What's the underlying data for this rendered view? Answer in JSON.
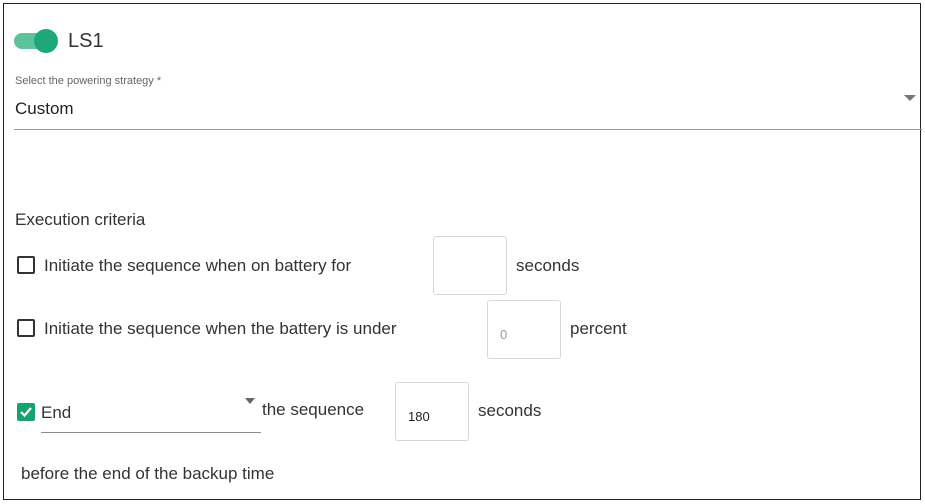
{
  "toggle": {
    "label": "LS1",
    "on": true
  },
  "strategy": {
    "caption": "Select the powering strategy *",
    "selected": "Custom"
  },
  "execution": {
    "title": "Execution criteria",
    "battery_time": {
      "checked": false,
      "label": "Initiate the sequence when on battery for",
      "value": "",
      "unit": "seconds"
    },
    "battery_level": {
      "checked": false,
      "label": "Initiate the sequence when the battery is under",
      "placeholder": "0",
      "unit": "percent"
    },
    "end_sequence": {
      "checked": true,
      "selected": "End",
      "label": "the sequence",
      "value": "180",
      "unit": "seconds",
      "note": "before the end of the backup time"
    }
  }
}
